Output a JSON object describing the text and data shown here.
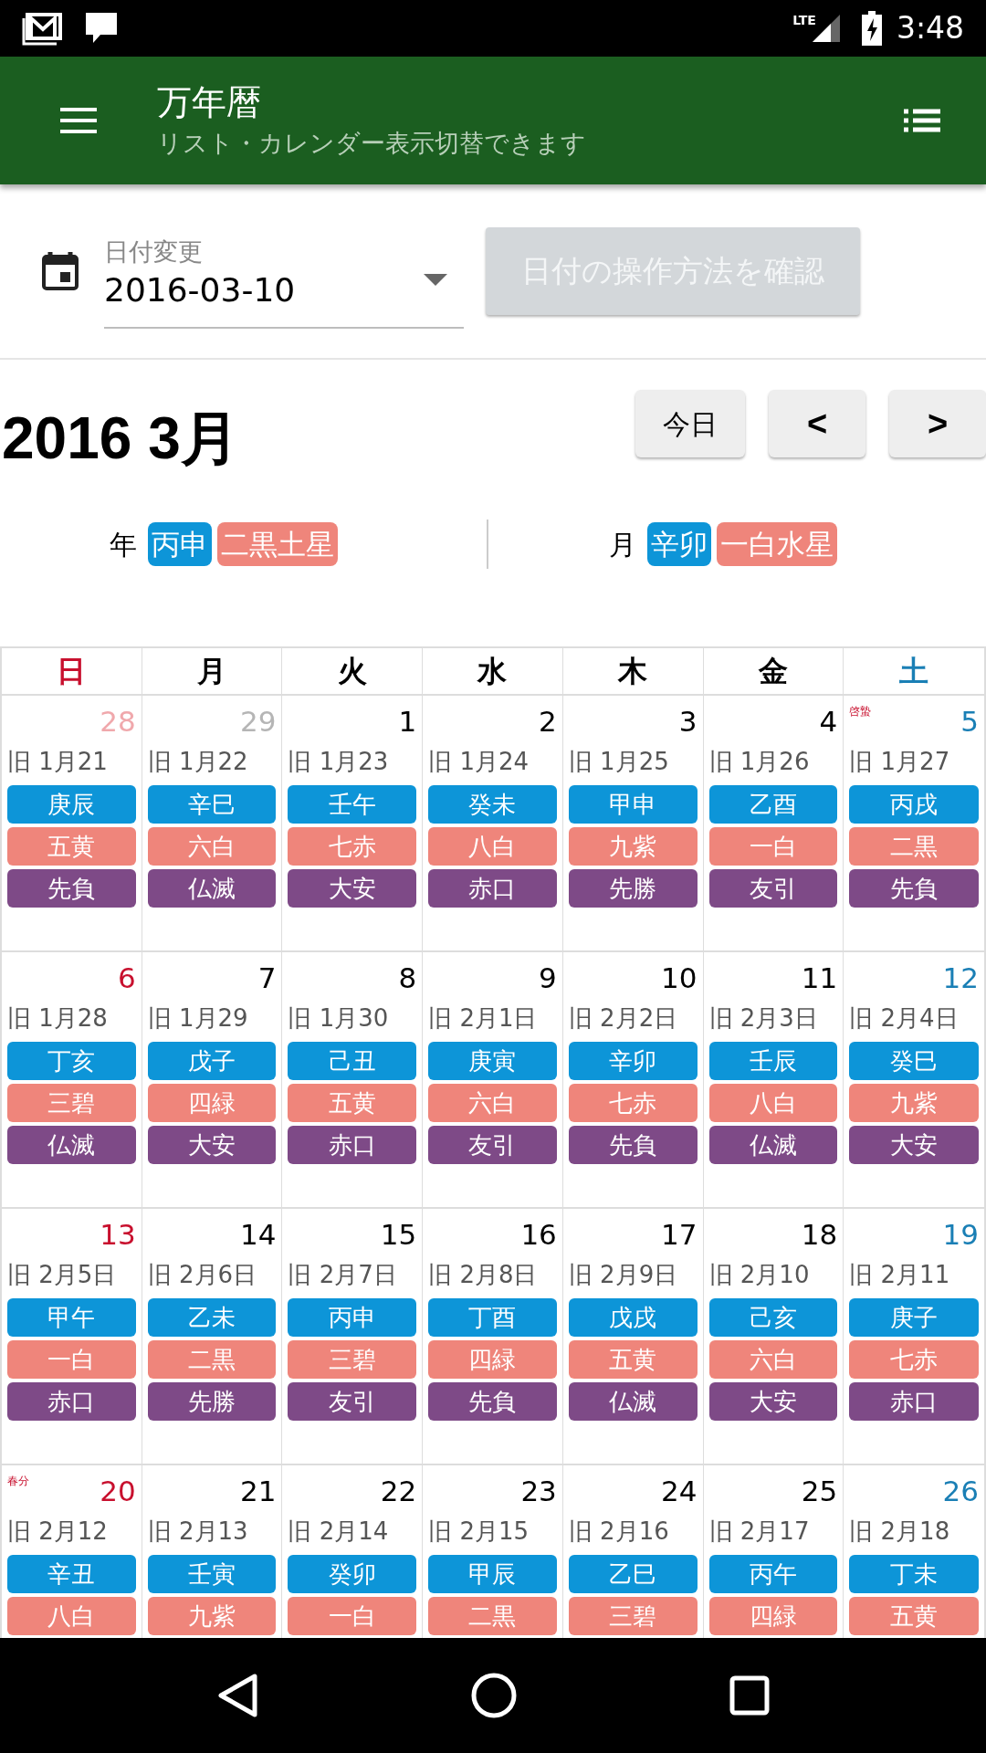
{
  "status_bar": {
    "network": "LTE",
    "time": "3:48"
  },
  "toolbar": {
    "title": "万年暦",
    "subtitle": "リスト・カレンダー表示切替できます"
  },
  "date_picker": {
    "label": "日付変更",
    "value": "2016-03-10"
  },
  "help_button": {
    "label": "日付の操作方法を確認",
    "disabled": true
  },
  "month_title": "2016 3月",
  "month_buttons": [
    {
      "label": "今日",
      "kind": "text"
    },
    {
      "label": "<",
      "kind": "arrow"
    },
    {
      "label": ">",
      "kind": "arrow"
    }
  ],
  "year_info": {
    "label": "年",
    "stem": "丙申",
    "star": "二黒土星"
  },
  "month_info": {
    "label": "月",
    "stem": "辛卯",
    "star": "一白水星"
  },
  "calendar": {
    "weekdays": [
      {
        "label": "日",
        "kind": "sunday"
      },
      {
        "label": "月",
        "kind": "weekday"
      },
      {
        "label": "火",
        "kind": "weekday"
      },
      {
        "label": "水",
        "kind": "weekday"
      },
      {
        "label": "木",
        "kind": "weekday"
      },
      {
        "label": "金",
        "kind": "weekday"
      },
      {
        "label": "土",
        "kind": "saturday"
      }
    ],
    "weeks": [
      {
        "days": [
          {
            "day": "28",
            "kind": "sunday",
            "other_month": true,
            "lunar": "旧 1月21",
            "stem": "庚辰",
            "star": "五黄",
            "rokuyo": "先負"
          },
          {
            "day": "29",
            "kind": "weekday",
            "other_month": true,
            "lunar": "旧 1月22",
            "stem": "辛巳",
            "star": "六白",
            "rokuyo": "仏滅"
          },
          {
            "day": "1",
            "kind": "weekday",
            "other_month": false,
            "lunar": "旧 1月23",
            "stem": "壬午",
            "star": "七赤",
            "rokuyo": "大安"
          },
          {
            "day": "2",
            "kind": "weekday",
            "other_month": false,
            "lunar": "旧 1月24",
            "stem": "癸未",
            "star": "八白",
            "rokuyo": "赤口"
          },
          {
            "day": "3",
            "kind": "weekday",
            "other_month": false,
            "lunar": "旧 1月25",
            "stem": "甲申",
            "star": "九紫",
            "rokuyo": "先勝"
          },
          {
            "day": "4",
            "kind": "weekday",
            "other_month": false,
            "lunar": "旧 1月26",
            "stem": "乙酉",
            "star": "一白",
            "rokuyo": "友引"
          },
          {
            "day": "5",
            "kind": "saturday",
            "other_month": false,
            "solar_term": "啓蟄",
            "lunar": "旧 1月27",
            "stem": "丙戌",
            "star": "二黒",
            "rokuyo": "先負"
          }
        ]
      },
      {
        "days": [
          {
            "day": "6",
            "kind": "sunday",
            "other_month": false,
            "lunar": "旧 1月28",
            "stem": "丁亥",
            "star": "三碧",
            "rokuyo": "仏滅"
          },
          {
            "day": "7",
            "kind": "weekday",
            "other_month": false,
            "lunar": "旧 1月29",
            "stem": "戊子",
            "star": "四緑",
            "rokuyo": "大安"
          },
          {
            "day": "8",
            "kind": "weekday",
            "other_month": false,
            "lunar": "旧 1月30",
            "stem": "己丑",
            "star": "五黄",
            "rokuyo": "赤口"
          },
          {
            "day": "9",
            "kind": "weekday",
            "other_month": false,
            "lunar": "旧 2月1日",
            "stem": "庚寅",
            "star": "六白",
            "rokuyo": "友引"
          },
          {
            "day": "10",
            "kind": "weekday",
            "other_month": false,
            "lunar": "旧 2月2日",
            "stem": "辛卯",
            "star": "七赤",
            "rokuyo": "先負"
          },
          {
            "day": "11",
            "kind": "weekday",
            "other_month": false,
            "lunar": "旧 2月3日",
            "stem": "壬辰",
            "star": "八白",
            "rokuyo": "仏滅"
          },
          {
            "day": "12",
            "kind": "saturday",
            "other_month": false,
            "lunar": "旧 2月4日",
            "stem": "癸巳",
            "star": "九紫",
            "rokuyo": "大安"
          }
        ]
      },
      {
        "days": [
          {
            "day": "13",
            "kind": "sunday",
            "other_month": false,
            "lunar": "旧 2月5日",
            "stem": "甲午",
            "star": "一白",
            "rokuyo": "赤口"
          },
          {
            "day": "14",
            "kind": "weekday",
            "other_month": false,
            "lunar": "旧 2月6日",
            "stem": "乙未",
            "star": "二黒",
            "rokuyo": "先勝"
          },
          {
            "day": "15",
            "kind": "weekday",
            "other_month": false,
            "lunar": "旧 2月7日",
            "stem": "丙申",
            "star": "三碧",
            "rokuyo": "友引"
          },
          {
            "day": "16",
            "kind": "weekday",
            "other_month": false,
            "lunar": "旧 2月8日",
            "stem": "丁酉",
            "star": "四緑",
            "rokuyo": "先負"
          },
          {
            "day": "17",
            "kind": "weekday",
            "other_month": false,
            "lunar": "旧 2月9日",
            "stem": "戊戌",
            "star": "五黄",
            "rokuyo": "仏滅"
          },
          {
            "day": "18",
            "kind": "weekday",
            "other_month": false,
            "lunar": "旧 2月10",
            "stem": "己亥",
            "star": "六白",
            "rokuyo": "大安"
          },
          {
            "day": "19",
            "kind": "saturday",
            "other_month": false,
            "lunar": "旧 2月11",
            "stem": "庚子",
            "star": "七赤",
            "rokuyo": "赤口"
          }
        ]
      },
      {
        "days": [
          {
            "day": "20",
            "kind": "sunday",
            "other_month": false,
            "solar_term": "春分",
            "lunar": "旧 2月12",
            "stem": "辛丑",
            "star": "八白"
          },
          {
            "day": "21",
            "kind": "weekday",
            "other_month": false,
            "lunar": "旧 2月13",
            "stem": "壬寅",
            "star": "九紫"
          },
          {
            "day": "22",
            "kind": "weekday",
            "other_month": false,
            "lunar": "旧 2月14",
            "stem": "癸卯",
            "star": "一白"
          },
          {
            "day": "23",
            "kind": "weekday",
            "other_month": false,
            "lunar": "旧 2月15",
            "stem": "甲辰",
            "star": "二黒"
          },
          {
            "day": "24",
            "kind": "weekday",
            "other_month": false,
            "lunar": "旧 2月16",
            "stem": "乙巳",
            "star": "三碧"
          },
          {
            "day": "25",
            "kind": "weekday",
            "other_month": false,
            "lunar": "旧 2月17",
            "stem": "丙午",
            "star": "四緑"
          },
          {
            "day": "26",
            "kind": "saturday",
            "other_month": false,
            "lunar": "旧 2月18",
            "stem": "丁未",
            "star": "五黄"
          }
        ]
      }
    ]
  }
}
